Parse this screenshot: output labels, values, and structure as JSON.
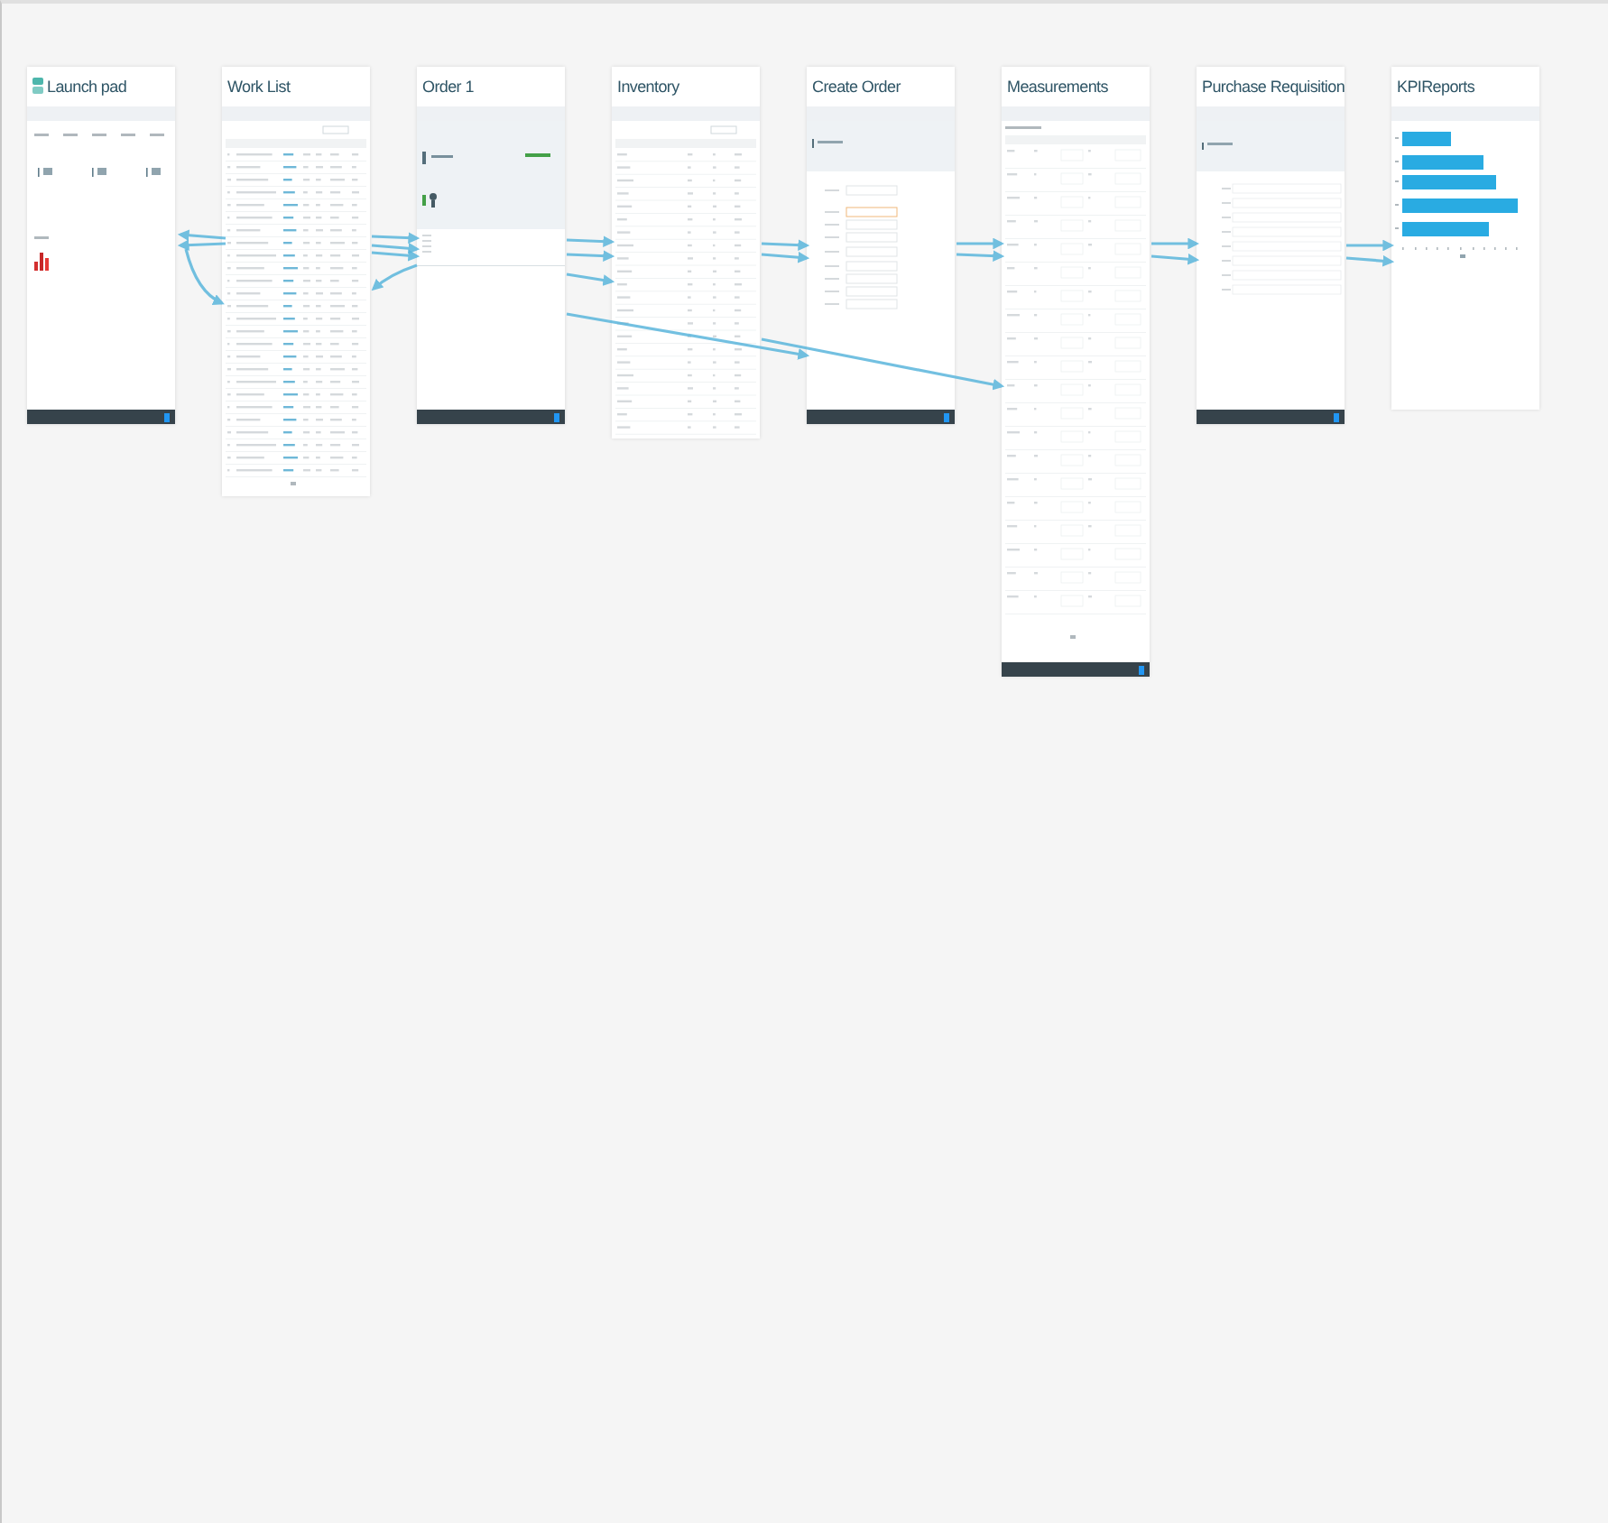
{
  "screens": [
    {
      "title": "Launch pad",
      "kind": "launchpad",
      "icon": true,
      "footer": true
    },
    {
      "title": "Work List",
      "kind": "list",
      "icon": false,
      "footer": false
    },
    {
      "title": "Order 1",
      "kind": "detail",
      "icon": false,
      "footer": true
    },
    {
      "title": "Inventory",
      "kind": "list-short",
      "icon": false,
      "footer": false
    },
    {
      "title": "Create Order",
      "kind": "form",
      "icon": false,
      "footer": true
    },
    {
      "title": "Measurements",
      "kind": "grid",
      "icon": false,
      "footer": true
    },
    {
      "title": "Purchase Requisition",
      "kind": "form-list",
      "icon": false,
      "footer": true
    },
    {
      "title": "KPIReports",
      "kind": "chart",
      "icon": false,
      "footer": false
    }
  ]
}
